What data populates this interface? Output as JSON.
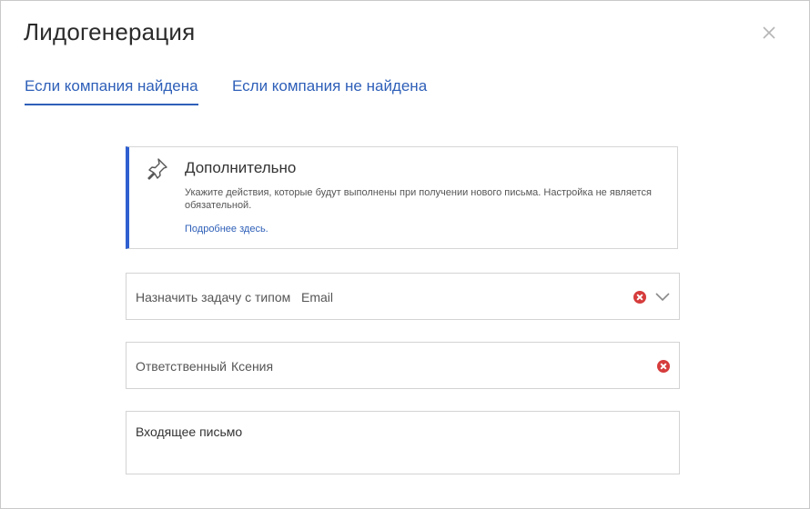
{
  "dialog": {
    "title": "Лидогенерация"
  },
  "tabs": [
    {
      "label": "Если компания найдена",
      "active": true
    },
    {
      "label": "Если компания не найдена",
      "active": false
    }
  ],
  "info": {
    "title": "Дополнительно",
    "description": "Укажите действия, которые будут выполнены при получении нового письма. Настройка не является обязательной.",
    "link": "Подробнее здесь."
  },
  "fields": {
    "task_type": {
      "label": "Назначить задачу с типом",
      "value": "Email"
    },
    "responsible": {
      "label": "Ответственный",
      "value": "Ксения"
    },
    "message": {
      "label": "Входящее письмо"
    }
  },
  "colors": {
    "accent": "#2e5fb8",
    "card_border": "#2f5fd0",
    "clear": "#d63c3c"
  }
}
